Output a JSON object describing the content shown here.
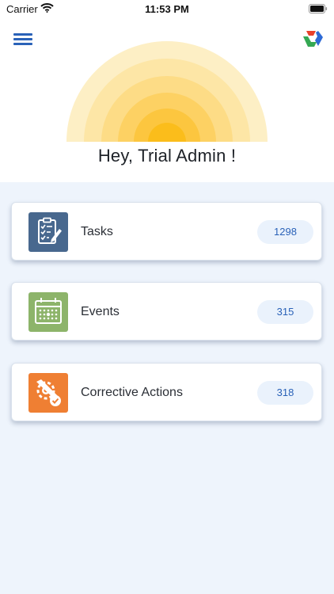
{
  "status_bar": {
    "carrier": "Carrier",
    "time": "11:53 PM"
  },
  "header": {
    "menu_icon": "hamburger-menu-icon",
    "logo_icon": "app-logo-icon"
  },
  "greeting": "Hey, Trial  Admin !",
  "modules": [
    {
      "label": "Tasks",
      "count": "1298",
      "icon": "task-checklist-icon",
      "color": "#48688e"
    },
    {
      "label": "Events",
      "count": "315",
      "icon": "calendar-icon",
      "color": "#8db46a"
    },
    {
      "label": "Corrective Actions",
      "count": "318",
      "icon": "corrective-action-icon",
      "color": "#ef7f33"
    }
  ],
  "colors": {
    "accent": "#2a62b8",
    "background": "#eef4fc",
    "count_pill": "#eaf2fc"
  }
}
